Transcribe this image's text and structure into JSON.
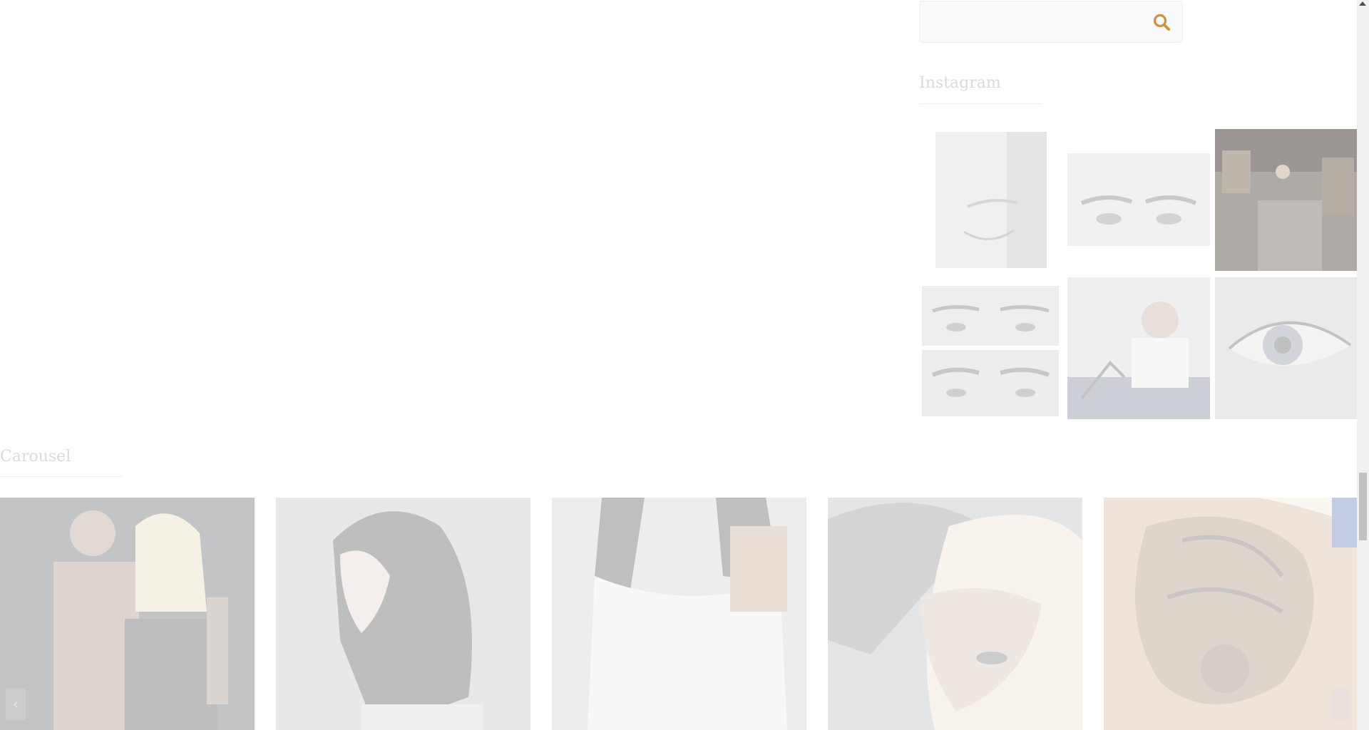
{
  "search": {
    "placeholder": "",
    "button_icon": "search-icon",
    "accent_color": "#d0913c"
  },
  "instagram": {
    "title": "Instagram",
    "images": [
      {
        "name": "instagram-photo-closed-eye",
        "subject": "woman with closed eye and light hair"
      },
      {
        "name": "instagram-photo-eyebrows",
        "subject": "close-up of eyes and eyebrows"
      },
      {
        "name": "instagram-photo-tattoo-studio",
        "subject": "tattoo studio interior"
      },
      {
        "name": "instagram-photo-eyebrows-before-after",
        "subject": "eyebrows before and after"
      },
      {
        "name": "instagram-photo-tattoo-artist",
        "subject": "tattoo artist working"
      },
      {
        "name": "instagram-photo-eye-closeup",
        "subject": "eye close-up with eyeliner"
      }
    ]
  },
  "carousel": {
    "title": "Carousel",
    "slides": [
      {
        "name": "carousel-slide-couple",
        "subject": "tattooed couple"
      },
      {
        "name": "carousel-slide-profile",
        "subject": "woman profile with dark hair"
      },
      {
        "name": "carousel-slide-white-top",
        "subject": "woman in white top with shoulder tattoo"
      },
      {
        "name": "carousel-slide-blonde",
        "subject": "blonde woman with arm tattoo"
      },
      {
        "name": "carousel-slide-back-tattoo",
        "subject": "back tattoo artwork"
      }
    ],
    "prev_icon": "chevron-left-icon",
    "next_icon": "chevron-right-icon"
  }
}
